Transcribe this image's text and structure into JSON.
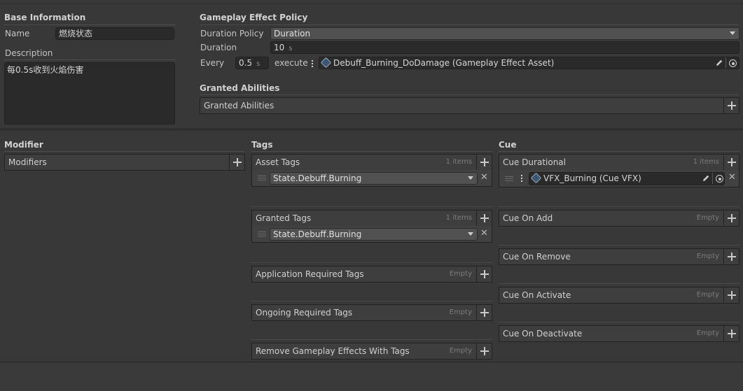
{
  "base": {
    "header": "Base Information",
    "name_label": "Name",
    "name_value": "燃烧状态",
    "description_label": "Description",
    "description_value": "每0.5s收到火焰伤害"
  },
  "policy": {
    "header": "Gameplay Effect Policy",
    "duration_policy_label": "Duration Policy",
    "duration_policy_value": "Duration",
    "duration_label": "Duration",
    "duration_value": "10",
    "duration_unit": "s",
    "every_label": "Every",
    "every_value": "0.5",
    "every_unit": "s",
    "execute_label": "execute",
    "execute_asset": "Debuff_Burning_DoDamage (Gameplay Effect Asset)"
  },
  "granted_abilities": {
    "header": "Granted Abilities",
    "list_title": "Granted Abilities"
  },
  "modifier": {
    "header": "Modifier",
    "list_title": "Modifiers"
  },
  "tags": {
    "header": "Tags",
    "asset_tags": {
      "title": "Asset Tags",
      "count": "1 items",
      "items": [
        "State.Debuff.Burning"
      ]
    },
    "granted_tags": {
      "title": "Granted Tags",
      "count": "1 items",
      "items": [
        "State.Debuff.Burning"
      ]
    },
    "application_required": {
      "title": "Application Required Tags",
      "count": "Empty"
    },
    "ongoing_required": {
      "title": "Ongoing Required Tags",
      "count": "Empty"
    },
    "remove_effects": {
      "title": "Remove Gameplay Effects With Tags",
      "count": "Empty"
    }
  },
  "cue": {
    "header": "Cue",
    "durational": {
      "title": "Cue Durational",
      "count": "1 items",
      "items": [
        "VFX_Burning (Cue VFX)"
      ]
    },
    "on_add": {
      "title": "Cue On Add",
      "count": "Empty"
    },
    "on_remove": {
      "title": "Cue On Remove",
      "count": "Empty"
    },
    "on_activate": {
      "title": "Cue On Activate",
      "count": "Empty"
    },
    "on_deactivate": {
      "title": "Cue On Deactivate",
      "count": "Empty"
    }
  },
  "icons": {
    "add": "plus-icon",
    "remove": "x-icon",
    "dropdown": "chevron-down-icon",
    "edit": "pencil-icon",
    "pick": "object-picker-icon",
    "asset": "asset-icon",
    "drag": "drag-handle-icon",
    "menu": "kebab-menu-icon"
  }
}
